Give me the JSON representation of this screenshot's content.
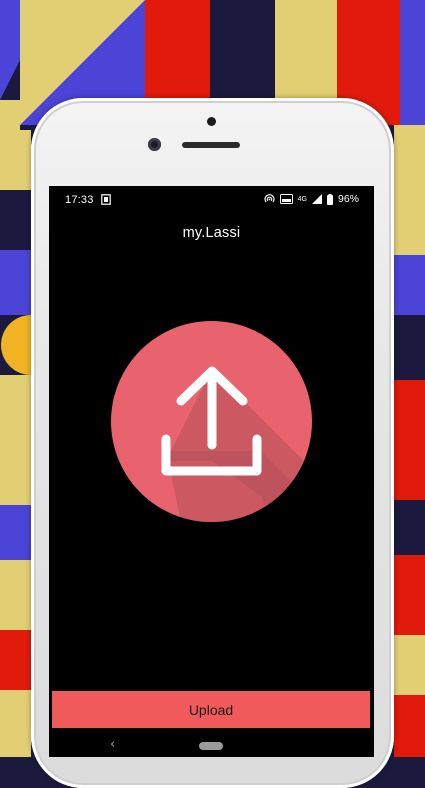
{
  "status_bar": {
    "time": "17:33",
    "battery_percent": "96%",
    "network_label": "4G",
    "icons": [
      "sim-card-icon",
      "hotspot-icon",
      "volte-icon",
      "signal-icon",
      "battery-icon"
    ]
  },
  "app": {
    "title": "my.Lassi",
    "upload_icon": "upload-icon",
    "upload_button_label": "Upload"
  },
  "nav": {
    "back_symbol": "‹",
    "icons": [
      "back-icon",
      "home-pill-icon"
    ]
  },
  "colors": {
    "circle": "#e8636e",
    "button": "#f15a5a",
    "screen_bg": "#000000",
    "bg_red": "#e11a0c",
    "bg_yellow": "#e2cf73",
    "bg_navy": "#1b1a3e",
    "bg_blue": "#4b44d6"
  }
}
